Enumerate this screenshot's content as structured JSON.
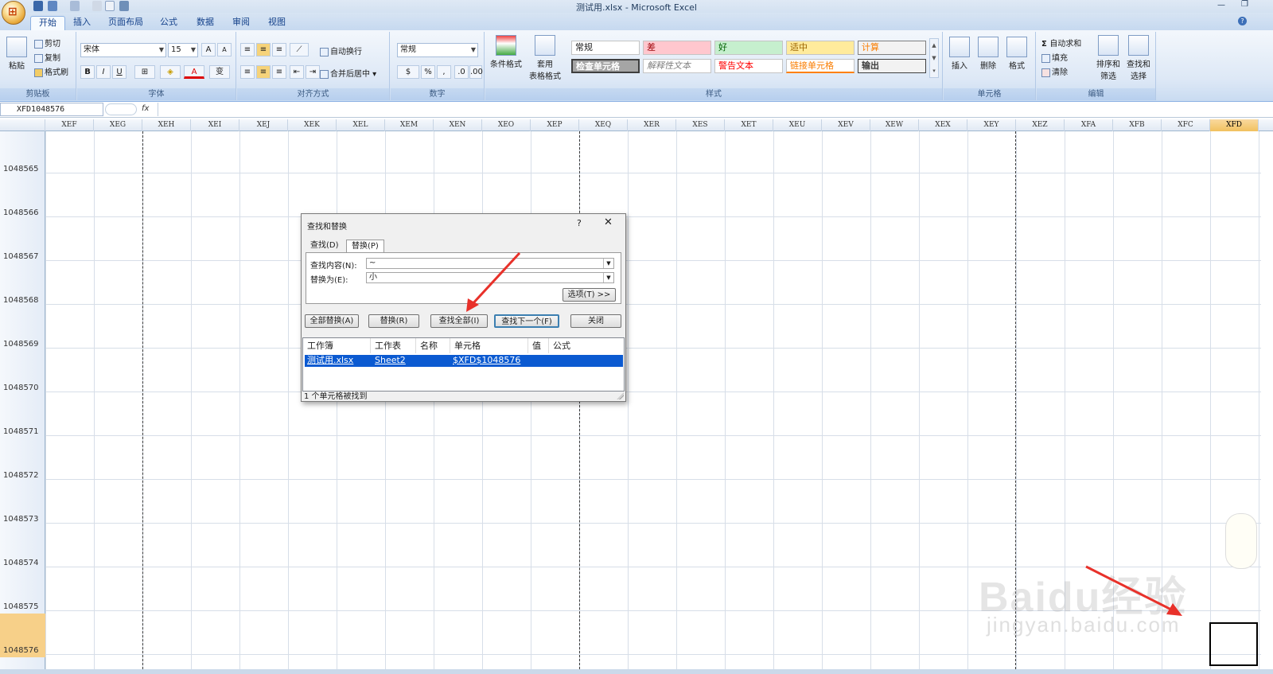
{
  "window": {
    "title": "测试用.xlsx - Microsoft Excel"
  },
  "ribbon_tabs": [
    "开始",
    "插入",
    "页面布局",
    "公式",
    "数据",
    "审阅",
    "视图"
  ],
  "ribbon": {
    "clipboard": {
      "paste": "粘贴",
      "cut": "剪切",
      "copy": "复制",
      "format_painter": "格式刷",
      "label": "剪贴板"
    },
    "font": {
      "name": "宋体",
      "size": "15",
      "bold": "B",
      "italic": "I",
      "underline": "U",
      "label": "字体"
    },
    "alignment": {
      "wrap": "自动换行",
      "merge": "合并后居中",
      "label": "对齐方式"
    },
    "number": {
      "format": "常规",
      "percent": "%",
      "label": "数字"
    },
    "styles": {
      "conditional": "条件格式",
      "table_format_1": "套用",
      "table_format_2": "表格格式",
      "cells": [
        "常规",
        "差",
        "好",
        "适中",
        "计算",
        "检查单元格",
        "解释性文本",
        "警告文本",
        "链接单元格",
        "输出"
      ],
      "label": "样式"
    },
    "cells_group": {
      "insert": "插入",
      "delete": "删除",
      "format": "格式",
      "label": "单元格"
    },
    "editing": {
      "autosum": "自动求和",
      "fill": "填充",
      "clear": "清除",
      "sort_1": "排序和",
      "sort_2": "筛选",
      "find_1": "查找和",
      "find_2": "选择",
      "label": "编辑"
    }
  },
  "formula_bar": {
    "name_box": "XFD1048576",
    "fx": "fx"
  },
  "columns": [
    "XEF",
    "XEG",
    "XEH",
    "XEI",
    "XEJ",
    "XEK",
    "XEL",
    "XEM",
    "XEN",
    "XEO",
    "XEP",
    "XEQ",
    "XER",
    "XES",
    "XET",
    "XEU",
    "XEV",
    "XEW",
    "XEX",
    "XEY",
    "XEZ",
    "XFA",
    "XFB",
    "XFC",
    "XFD"
  ],
  "rows": [
    "1048565",
    "1048566",
    "1048567",
    "1048568",
    "1048569",
    "1048570",
    "1048571",
    "1048572",
    "1048573",
    "1048574",
    "1048575",
    "1048576"
  ],
  "dialog": {
    "title": "查找和替换",
    "help": "?",
    "close": "✕",
    "tabs": [
      "查找(D)",
      "替换(P)"
    ],
    "find_label": "查找内容(N):",
    "find_value": "~",
    "replace_label": "替换为(E):",
    "replace_value": "小",
    "options_button": "选项(T) >>",
    "buttons": [
      "全部替换(A)",
      "替换(R)",
      "查找全部(I)",
      "查找下一个(F)",
      "关闭"
    ],
    "result_headers": [
      "工作簿",
      "工作表",
      "名称",
      "单元格",
      "值",
      "公式"
    ],
    "result_row": {
      "workbook": "测试用.xlsx",
      "sheet": "Sheet2",
      "cell": "$XFD$1048576"
    },
    "status": "1 个单元格被找到"
  },
  "watermark": {
    "brand": "Baidu经验",
    "url": "jingyan.baidu.com"
  },
  "colors": {
    "selection": "#0b5ad1",
    "arrow": "#e8312a",
    "header_selected": "#f1c15f"
  }
}
